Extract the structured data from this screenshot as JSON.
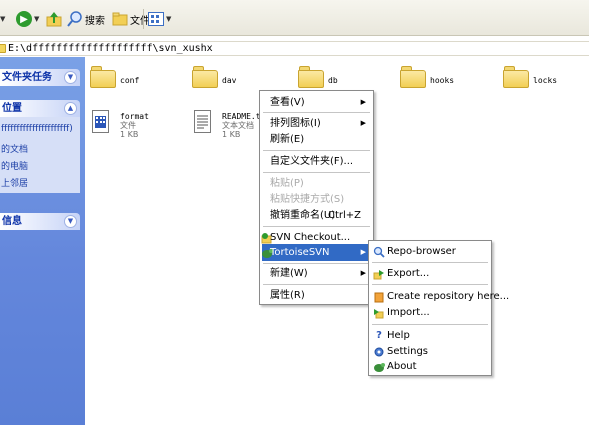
{
  "toolbar": {
    "search_label": "搜索",
    "folders_label": "文件夹"
  },
  "address": {
    "path": "E:\\dffffffffffffffffffff\\svn_xushx"
  },
  "left_panel": {
    "file_tasks_title": "文件夹任务",
    "other_places_title": "位置",
    "other_places_links": [
      "ffffffffffffffffffffff)",
      "的文档",
      "的电脑",
      "上邻居"
    ],
    "details_title": "信息"
  },
  "files": [
    {
      "name": "conf",
      "type": "folder"
    },
    {
      "name": "dav",
      "type": "folder"
    },
    {
      "name": "db",
      "type": "folder"
    },
    {
      "name": "hooks",
      "type": "folder"
    },
    {
      "name": "locks",
      "type": "folder"
    },
    {
      "name": "format",
      "type": "file",
      "kind": "文件",
      "size": "1 KB"
    },
    {
      "name": "README.txt",
      "type": "file",
      "kind": "文本文档",
      "size": "1 KB"
    }
  ],
  "context_menu": {
    "items": [
      {
        "label": "查看(V)",
        "submenu": true
      },
      {
        "label": "排列图标(I)",
        "submenu": true
      },
      {
        "label": "刷新(E)"
      },
      {
        "label": "自定义文件夹(F)..."
      },
      {
        "label": "粘贴(P)",
        "disabled": true
      },
      {
        "label": "粘贴快捷方式(S)",
        "disabled": true
      },
      {
        "label": "撤销重命名(U)",
        "shortcut": "Ctrl+Z"
      },
      {
        "label": "SVN Checkout...",
        "icon": "svn-checkout-icon"
      },
      {
        "label": "TortoiseSVN",
        "submenu": true,
        "highlighted": true,
        "icon": "tortoisesvn-icon"
      },
      {
        "label": "新建(W)",
        "submenu": true
      },
      {
        "label": "属性(R)"
      }
    ]
  },
  "submenu": {
    "items": [
      {
        "label": "Repo-browser",
        "icon": "repo-browser-icon"
      },
      {
        "label": "Export...",
        "icon": "export-icon"
      },
      {
        "label": "Create repository here...",
        "icon": "create-repo-icon"
      },
      {
        "label": "Import...",
        "icon": "import-icon"
      },
      {
        "label": "Help",
        "icon": "help-icon"
      },
      {
        "label": "Settings",
        "icon": "settings-icon"
      },
      {
        "label": "About",
        "icon": "about-icon"
      }
    ]
  },
  "colors": {
    "highlight": "#316ac5",
    "taskpane": "#6b8fe0",
    "folder": "#f2cf55"
  }
}
